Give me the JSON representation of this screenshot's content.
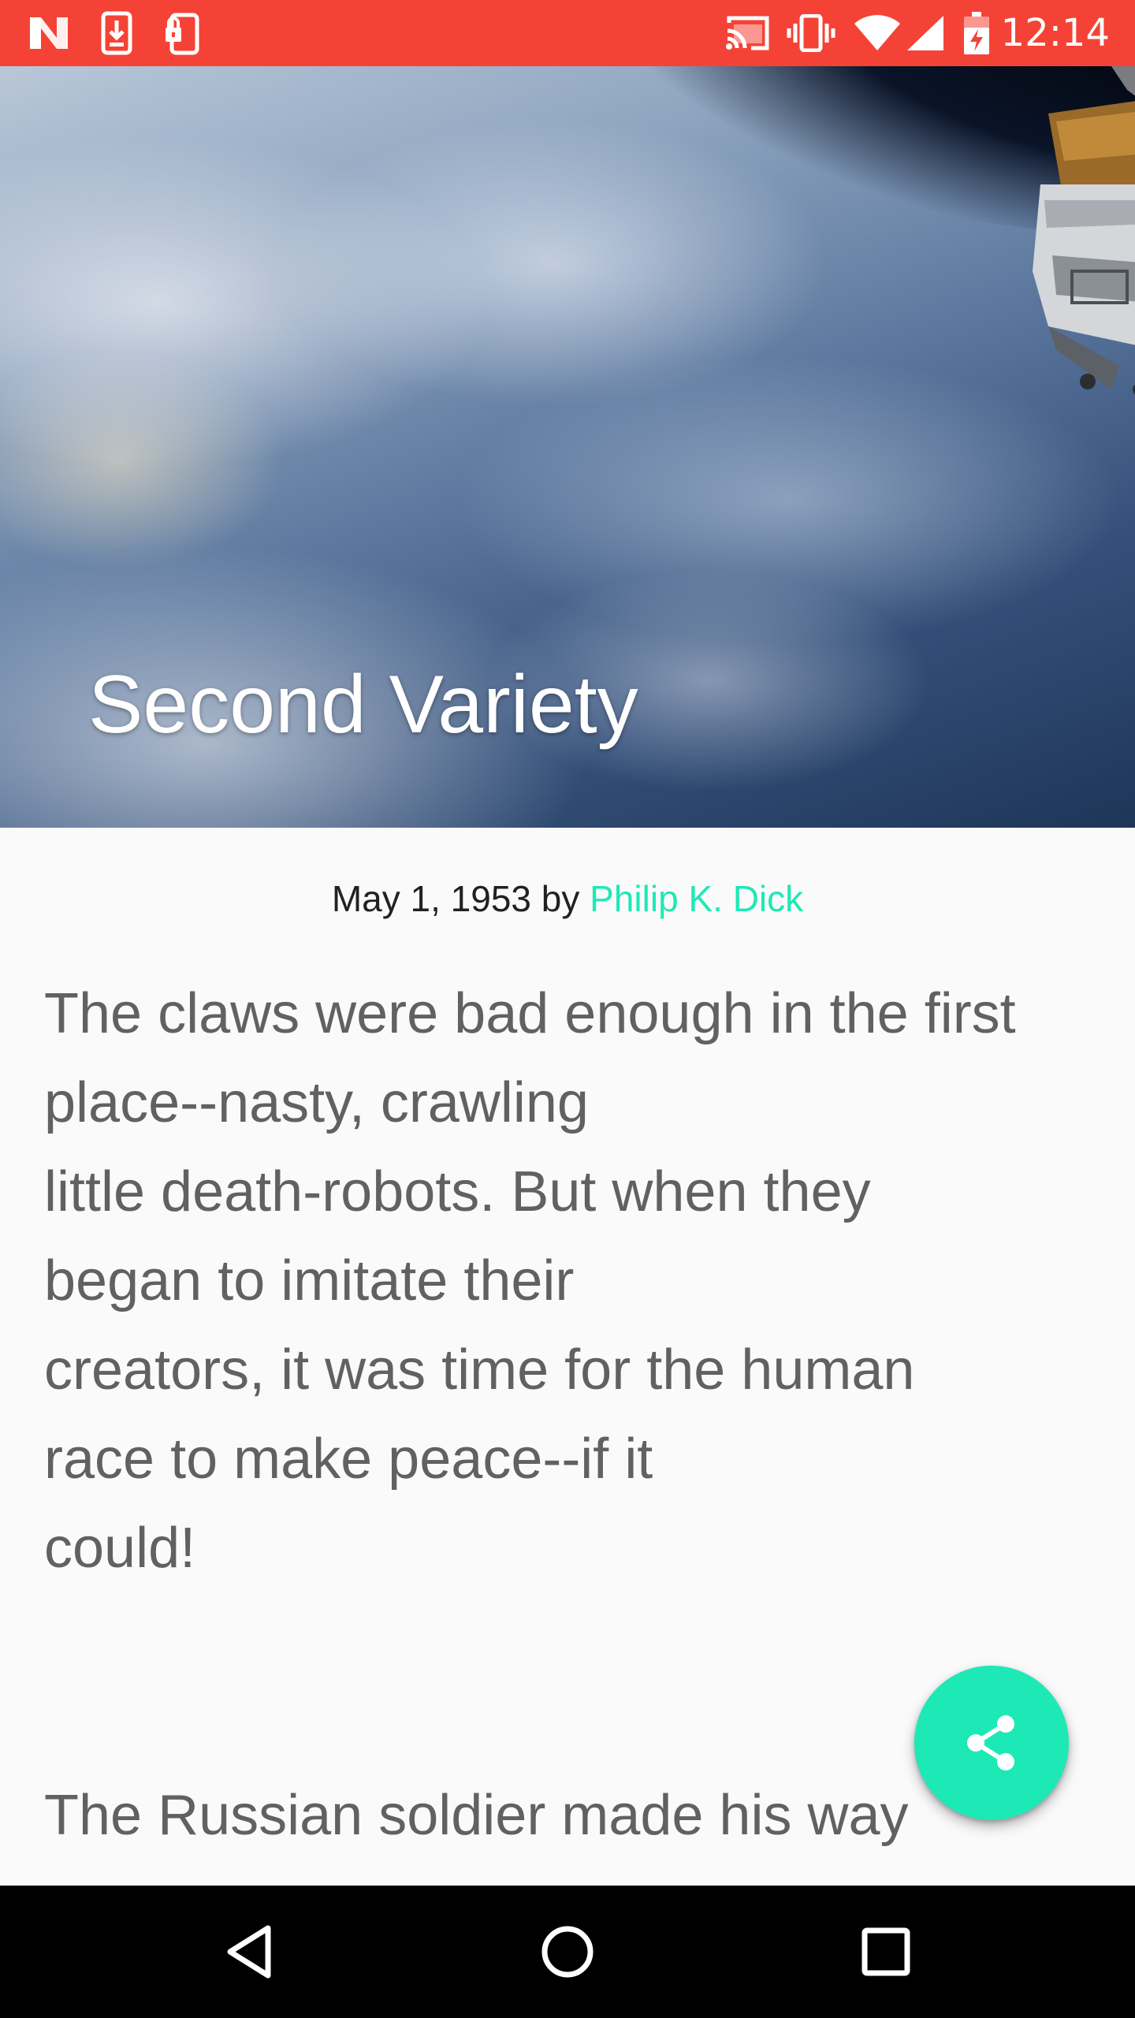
{
  "status_bar": {
    "time": "12:14",
    "left_icons": [
      "n-notification-icon",
      "download-icon",
      "phone-lock-icon"
    ],
    "right_icons": [
      "cast-icon",
      "vibrate-icon",
      "wifi-icon",
      "signal-icon",
      "battery-icon"
    ],
    "background_color": "#f44336"
  },
  "hero": {
    "title": "Second Variety"
  },
  "meta": {
    "date_by": "May 1, 1953 by ",
    "author": "Philip K. Dick",
    "author_color": "#1de9b6"
  },
  "article": {
    "paragraphs": [
      "The claws were bad enough in the first\nplace--nasty, crawling\nlittle death-robots. But when they\nbegan to imitate their\ncreators, it was time for the human\nrace to make peace--if it\ncould!",
      "The Russian soldier made his way"
    ]
  },
  "fab": {
    "icon": "share-icon",
    "color": "#1de9b6"
  },
  "nav_bar": {
    "buttons": [
      "back-icon",
      "home-icon",
      "recents-icon"
    ]
  }
}
